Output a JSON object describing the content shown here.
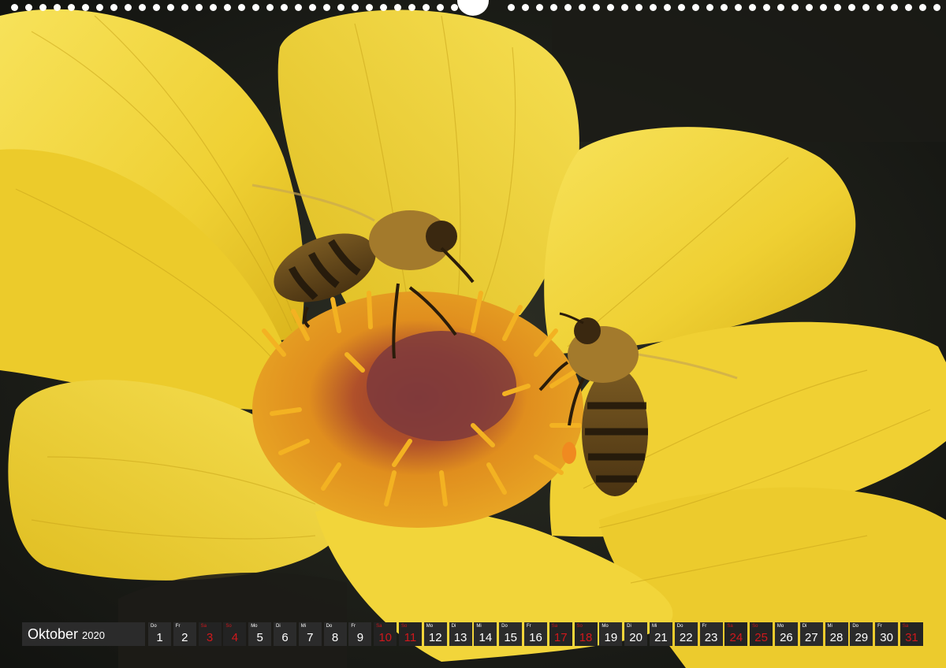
{
  "calendar": {
    "month": "Oktober",
    "year": "2020",
    "weekend_color": "#d0181c",
    "days": [
      {
        "wd": "Do",
        "num": "1",
        "weekend": false
      },
      {
        "wd": "Fr",
        "num": "2",
        "weekend": false
      },
      {
        "wd": "Sa",
        "num": "3",
        "weekend": true
      },
      {
        "wd": "So",
        "num": "4",
        "weekend": true
      },
      {
        "wd": "Mo",
        "num": "5",
        "weekend": false
      },
      {
        "wd": "Di",
        "num": "6",
        "weekend": false
      },
      {
        "wd": "Mi",
        "num": "7",
        "weekend": false
      },
      {
        "wd": "Do",
        "num": "8",
        "weekend": false
      },
      {
        "wd": "Fr",
        "num": "9",
        "weekend": false
      },
      {
        "wd": "Sa",
        "num": "10",
        "weekend": true
      },
      {
        "wd": "So",
        "num": "11",
        "weekend": true
      },
      {
        "wd": "Mo",
        "num": "12",
        "weekend": false
      },
      {
        "wd": "Di",
        "num": "13",
        "weekend": false
      },
      {
        "wd": "Mi",
        "num": "14",
        "weekend": false
      },
      {
        "wd": "Do",
        "num": "15",
        "weekend": false
      },
      {
        "wd": "Fr",
        "num": "16",
        "weekend": false
      },
      {
        "wd": "Sa",
        "num": "17",
        "weekend": true
      },
      {
        "wd": "So",
        "num": "18",
        "weekend": true
      },
      {
        "wd": "Mo",
        "num": "19",
        "weekend": false
      },
      {
        "wd": "Di",
        "num": "20",
        "weekend": false
      },
      {
        "wd": "Mi",
        "num": "21",
        "weekend": false
      },
      {
        "wd": "Do",
        "num": "22",
        "weekend": false
      },
      {
        "wd": "Fr",
        "num": "23",
        "weekend": false
      },
      {
        "wd": "Sa",
        "num": "24",
        "weekend": true
      },
      {
        "wd": "So",
        "num": "25",
        "weekend": true
      },
      {
        "wd": "Mo",
        "num": "26",
        "weekend": false
      },
      {
        "wd": "Di",
        "num": "27",
        "weekend": false
      },
      {
        "wd": "Mi",
        "num": "28",
        "weekend": false
      },
      {
        "wd": "Do",
        "num": "29",
        "weekend": false
      },
      {
        "wd": "Fr",
        "num": "30",
        "weekend": false
      },
      {
        "wd": "Sa",
        "num": "31",
        "weekend": true
      }
    ]
  },
  "photo": {
    "subject": "bees-on-yellow-dahlia",
    "petal_color": "#f2d52e",
    "center_color": "#e8a020",
    "background_color": "#1f211b"
  }
}
